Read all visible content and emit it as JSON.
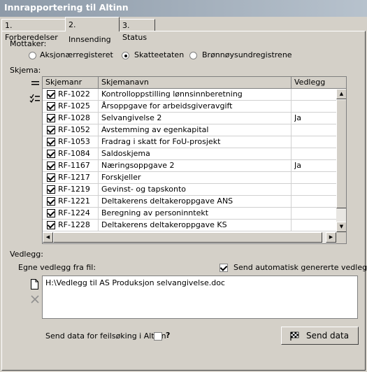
{
  "window": {
    "title": "Innrapportering til Altinn"
  },
  "tabs": [
    {
      "label": "1. Forberedelser"
    },
    {
      "label": "2. Innsending"
    },
    {
      "label": "3. Status"
    }
  ],
  "recipient": {
    "label": "Mottaker:",
    "options": [
      {
        "label": "Aksjonærregisteret",
        "selected": false
      },
      {
        "label": "Skatteetaten",
        "selected": true
      },
      {
        "label": "Brønnøysundregistrene",
        "selected": false
      }
    ]
  },
  "forms": {
    "label": "Skjema:",
    "columns": {
      "number": "Skjemanr",
      "name": "Skjemanavn",
      "attachment": "Vedlegg"
    },
    "rows": [
      {
        "number": "RF-1022",
        "name": "Kontrolloppstilling lønnsinnberetning",
        "attachment": "",
        "checked": true
      },
      {
        "number": "RF-1025",
        "name": "Årsoppgave for arbeidsgiveravgift",
        "attachment": "",
        "checked": true
      },
      {
        "number": "RF-1028",
        "name": "Selvangivelse 2",
        "attachment": "Ja",
        "checked": true
      },
      {
        "number": "RF-1052",
        "name": "Avstemming av egenkapital",
        "attachment": "",
        "checked": true
      },
      {
        "number": "RF-1053",
        "name": "Fradrag i skatt for FoU-prosjekt",
        "attachment": "",
        "checked": true
      },
      {
        "number": "RF-1084",
        "name": "Saldoskjema",
        "attachment": "",
        "checked": true
      },
      {
        "number": "RF-1167",
        "name": "Næringsoppgave 2",
        "attachment": "Ja",
        "checked": true
      },
      {
        "number": "RF-1217",
        "name": "Forskjeller",
        "attachment": "",
        "checked": true
      },
      {
        "number": "RF-1219",
        "name": "Gevinst- og tapskonto",
        "attachment": "",
        "checked": true
      },
      {
        "number": "RF-1221",
        "name": "Deltakerens deltakeroppgave ANS",
        "attachment": "",
        "checked": true
      },
      {
        "number": "RF-1224",
        "name": "Beregning av personinntekt",
        "attachment": "",
        "checked": true
      },
      {
        "number": "RF-1228",
        "name": "Deltakerens deltakeroppgave KS",
        "attachment": "",
        "checked": true
      }
    ]
  },
  "attachments": {
    "label": "Vedlegg:",
    "own_label": "Egne vedlegg fra fil:",
    "auto_label": "Send automatisk genererte vedlegg",
    "auto_checked": true,
    "files": "H:\\Vedlegg til AS Produksjon selvangivelse.doc"
  },
  "footer": {
    "debug_label": "Send data for feilsøking i Altinn",
    "help_label": "?",
    "send_label": "Send data"
  }
}
